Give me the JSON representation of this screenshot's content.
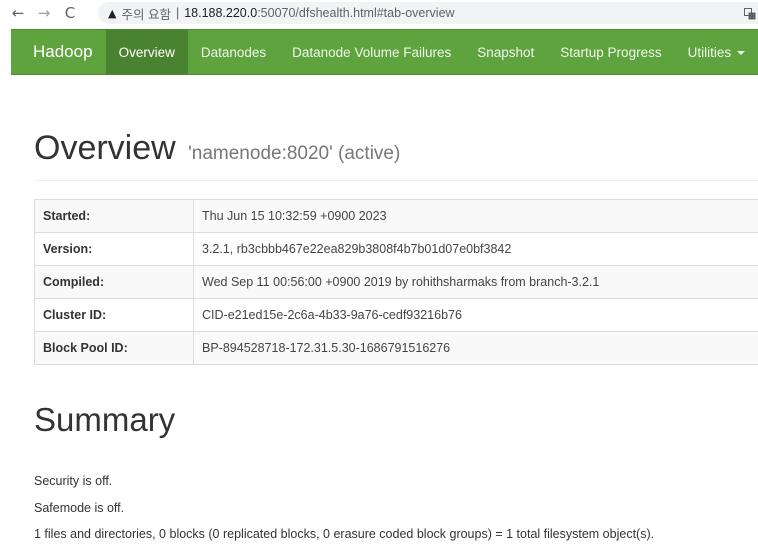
{
  "browser": {
    "back_icon": "←",
    "forward_icon": "→",
    "reload_icon": "C",
    "warning_icon": "▲",
    "warning_text": "주의 요함",
    "separator": "|",
    "url_host": "18.188.220.0",
    "url_path": ":50070/dfshealth.html#tab-overview"
  },
  "navbar": {
    "brand": "Hadoop",
    "items": [
      {
        "label": "Overview"
      },
      {
        "label": "Datanodes"
      },
      {
        "label": "Datanode Volume Failures"
      },
      {
        "label": "Snapshot"
      },
      {
        "label": "Startup Progress"
      },
      {
        "label": "Utilities"
      }
    ],
    "colors": {
      "bar": "#5fa33e",
      "active": "#4a8330"
    }
  },
  "overview": {
    "title": "Overview",
    "subtitle": "'namenode:8020' (active)",
    "rows": [
      {
        "label": "Started:",
        "value": "Thu Jun 15 10:32:59 +0900 2023"
      },
      {
        "label": "Version:",
        "value": "3.2.1, rb3cbbb467e22ea829b3808f4b7b01d07e0bf3842"
      },
      {
        "label": "Compiled:",
        "value": "Wed Sep 11 00:56:00 +0900 2019 by rohithsharmaks from branch-3.2.1"
      },
      {
        "label": "Cluster ID:",
        "value": "CID-e21ed15e-2c6a-4b33-9a76-cedf93216b76"
      },
      {
        "label": "Block Pool ID:",
        "value": "BP-894528718-172.31.5.30-1686791516276"
      }
    ]
  },
  "summary": {
    "title": "Summary",
    "security": "Security is off.",
    "safemode": "Safemode is off.",
    "filesystem": "1 files and directories, 0 blocks (0 replicated blocks, 0 erasure coded block groups) = 1 total filesystem object(s)."
  }
}
